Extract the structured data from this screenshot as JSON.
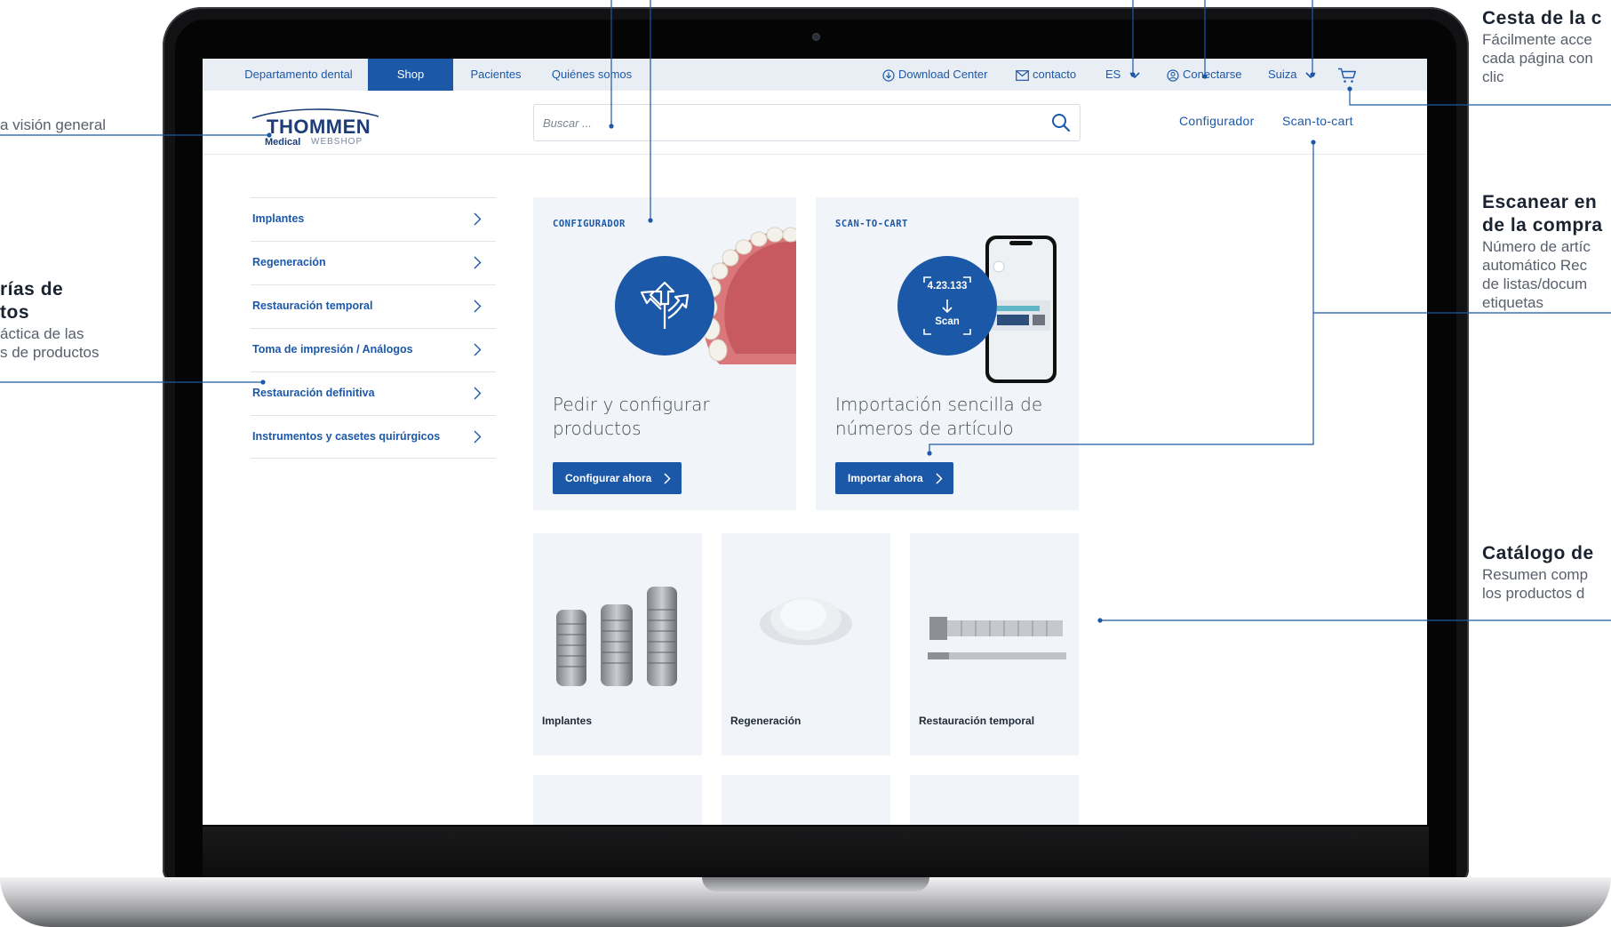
{
  "topbar": {
    "tabs": [
      {
        "label": "Departamento dental"
      },
      {
        "label": "Shop",
        "active": true
      },
      {
        "label": "Pacientes"
      },
      {
        "label": "Quiénes somos"
      }
    ],
    "download": "Download Center",
    "contact": "contacto",
    "language": "ES",
    "login": "Conectarse",
    "country": "Suiza"
  },
  "header": {
    "logo_brand": "THOMMEN",
    "logo_sub1": "Medical",
    "logo_sub2": "WEBSHOP",
    "search_placeholder": "Buscar ...",
    "link_configurator": "Configurador",
    "link_scan": "Scan-to-cart"
  },
  "sidebar": {
    "items": [
      {
        "label": "Implantes"
      },
      {
        "label": "Regeneración"
      },
      {
        "label": "Restauración temporal"
      },
      {
        "label": "Toma de impresión / Análogos"
      },
      {
        "label": "Restauración definitiva"
      },
      {
        "label": "Instrumentos y casetes quirúrgicos"
      }
    ]
  },
  "promo": {
    "configurator": {
      "kicker": "CONFIGURADOR",
      "headline_1": "Pedir y configurar",
      "headline_2": "productos",
      "cta": "Configurar ahora"
    },
    "scan": {
      "kicker": "SCAN-TO-CART",
      "headline_1": "Importación sencilla de",
      "headline_2": "números de artículo",
      "cta": "Importar ahora",
      "badge_number": "4.23.133",
      "badge_label": "Scan"
    }
  },
  "catalog": {
    "items": [
      {
        "label": "Implantes"
      },
      {
        "label": "Regeneración"
      },
      {
        "label": "Restauración temporal"
      }
    ]
  },
  "annotations": {
    "left_top": "a visión general",
    "left_mid_title_1": "rías de",
    "left_mid_title_2": "tos",
    "left_mid_desc_1": "áctica de las",
    "left_mid_desc_2": "s de productos",
    "right_cart_title": "Cesta de la c",
    "right_cart_desc_1": "Fácilmente acce",
    "right_cart_desc_2": "cada página con",
    "right_cart_desc_3": "clic",
    "right_scan_title_1": "Escanear en",
    "right_scan_title_2": "de la compra",
    "right_scan_desc_1": "Número de artíc",
    "right_scan_desc_2": "automático Rec",
    "right_scan_desc_3": "de listas/docum",
    "right_scan_desc_4": "etiquetas",
    "right_catalog_title": "Catálogo de",
    "right_catalog_desc_1": "Resumen comp",
    "right_catalog_desc_2": "los productos d"
  },
  "colors": {
    "accent": "#1c58a8",
    "topbar_bg": "#e9eef5",
    "card_bg": "#f1f4f8",
    "annotation_line": "#1c58a8"
  }
}
